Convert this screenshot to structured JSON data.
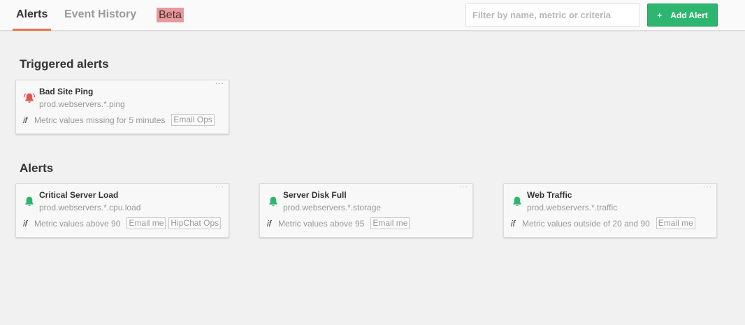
{
  "tabs": [
    {
      "label": "Alerts",
      "active": true
    },
    {
      "label": "Event History",
      "active": false
    }
  ],
  "beta_badge": "Beta",
  "filter": {
    "placeholder": "Filter by name, metric or criteria",
    "value": ""
  },
  "add_alert": {
    "icon": "+",
    "label": "Add Alert"
  },
  "colors": {
    "accent_tab": "#e8764a",
    "add_button": "#2db670",
    "bell_ok": "#2db670",
    "bell_triggered": "#e0584f",
    "beta": "#e8999b"
  },
  "triggered": {
    "title": "Triggered alerts",
    "cards": [
      {
        "name": "Bad Site Ping",
        "path": "prod.webservers.*.ping",
        "if": "if",
        "condition": "Metric values missing for 5 minutes",
        "tags": [
          "Email Ops"
        ],
        "icon": "ringing-bell-icon",
        "menu": "···"
      }
    ]
  },
  "alerts": {
    "title": "Alerts",
    "cards": [
      {
        "name": "Critical Server Load",
        "path": "prod.webservers.*.cpu.load",
        "if": "if",
        "condition": "Metric values above 90",
        "tags": [
          "Email me",
          "HipChat Ops"
        ],
        "icon": "bell-icon",
        "menu": "···"
      },
      {
        "name": "Server Disk Full",
        "path": "prod.webservers.*.storage",
        "if": "if",
        "condition": "Metric values above 95",
        "tags": [
          "Email me"
        ],
        "icon": "bell-icon",
        "menu": "···"
      },
      {
        "name": "Web Traffic",
        "path": "prod.webservers.*.traffic",
        "if": "if",
        "condition": "Metric values outside of 20 and 90",
        "tags": [
          "Email me"
        ],
        "icon": "bell-icon",
        "menu": "···"
      }
    ]
  }
}
